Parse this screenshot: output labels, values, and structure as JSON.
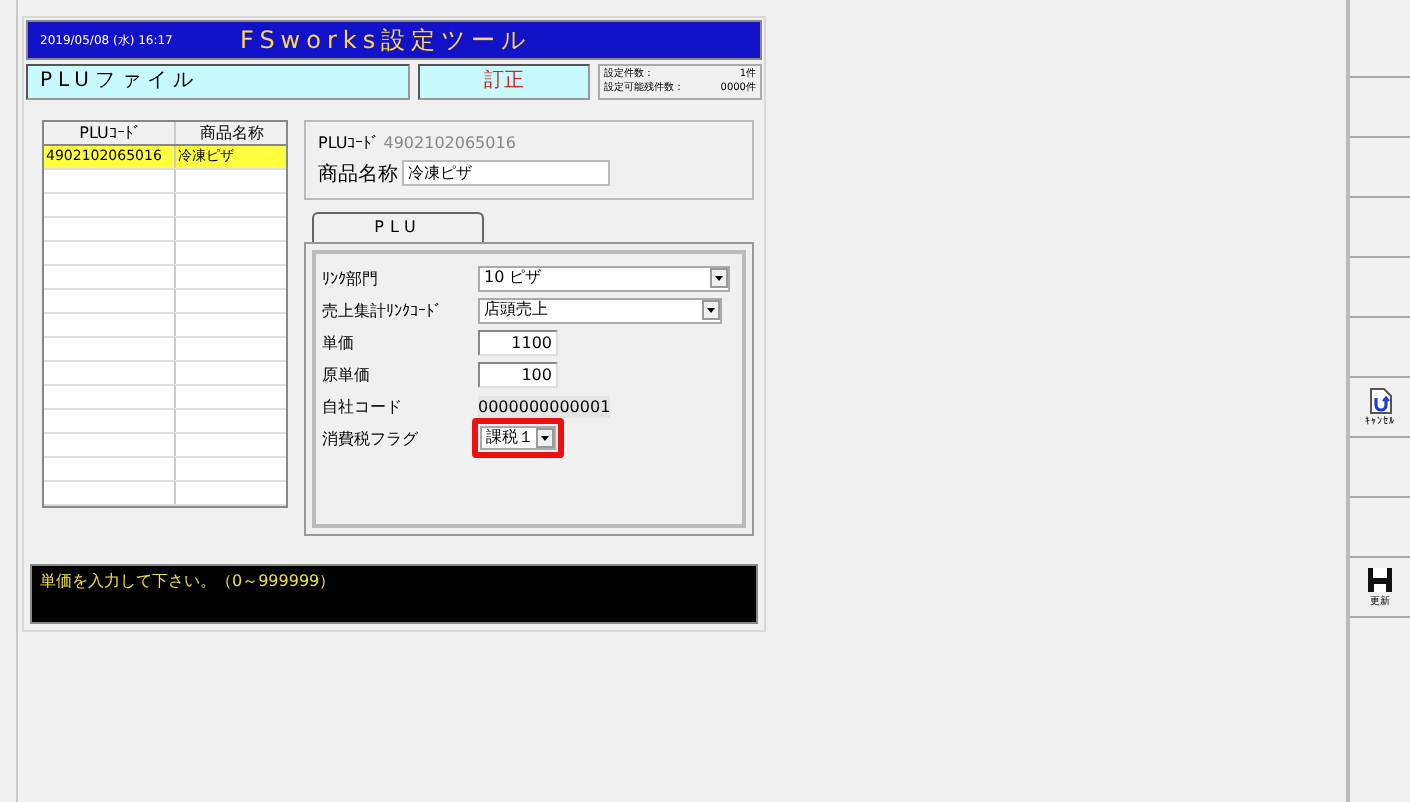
{
  "title_bar": {
    "datetime": "2019/05/08 (水) 16:17",
    "title": "FSworks設定ツール"
  },
  "file_bar": {
    "file_name": "PLUファイル",
    "mode": "訂正",
    "counts": [
      {
        "label": "設定件数：",
        "value": "1件"
      },
      {
        "label": "設定可能残件数：",
        "value": "0000件"
      }
    ]
  },
  "table": {
    "columns": [
      "PLUｺｰﾄﾞ",
      "商品名称"
    ],
    "rows": [
      {
        "cells": [
          "4902102065016",
          "冷凍ピザ"
        ],
        "selected": true
      }
    ]
  },
  "header_form": {
    "code_label": "PLUｺｰﾄﾞ",
    "code_value": "4902102065016",
    "name_label": "商品名称",
    "name_value": "冷凍ピザ"
  },
  "tab": {
    "label": "PLU",
    "selected": true
  },
  "fields": [
    {
      "label": "ﾘﾝｸ部門",
      "value": "10 ピザ",
      "kind": "combo",
      "highlighted": false
    },
    {
      "label": "売上集計ﾘﾝｸｺｰﾄﾞ",
      "value": "店頭売上",
      "kind": "combo",
      "highlighted": false
    },
    {
      "label": "単価",
      "value": "1100",
      "kind": "number",
      "highlighted": false
    },
    {
      "label": "原単価",
      "value": "100",
      "kind": "number",
      "highlighted": false
    },
    {
      "label": "自社コード",
      "value": "0000000000001",
      "kind": "readonly",
      "highlighted": false
    },
    {
      "label": "消費税フラグ",
      "value": "課税１",
      "kind": "small-combo",
      "highlighted": true
    }
  ],
  "message": "単価を入力して下さい。（0～999999）",
  "toolbar": [
    {
      "kind": "blank"
    },
    {
      "kind": "blank"
    },
    {
      "kind": "blank"
    },
    {
      "kind": "blank"
    },
    {
      "kind": "blank"
    },
    {
      "kind": "blank"
    },
    {
      "kind": "cancel",
      "label": "ｷｬﾝｾﾙ"
    },
    {
      "kind": "blank"
    },
    {
      "kind": "blank"
    },
    {
      "kind": "save",
      "label": "更新"
    }
  ]
}
